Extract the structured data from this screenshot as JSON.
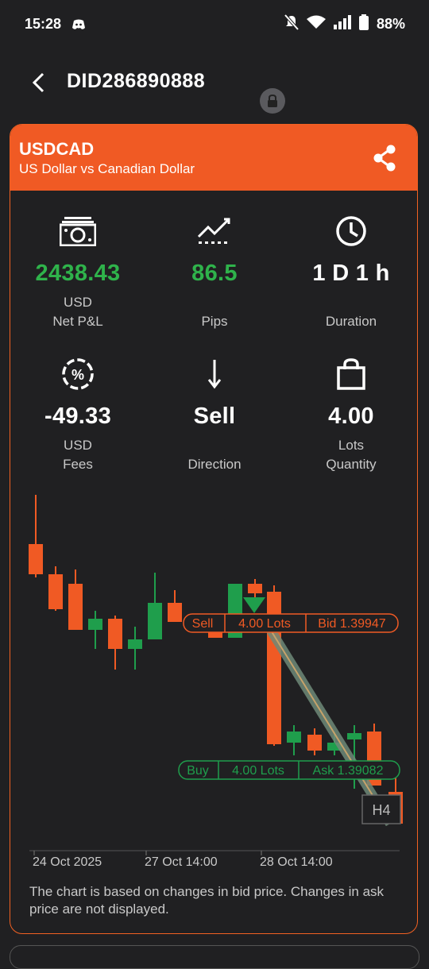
{
  "status": {
    "time": "15:28",
    "battery": "88%"
  },
  "header": {
    "title": "DID286890888"
  },
  "card": {
    "symbol": "USDCAD",
    "description": "US Dollar vs Canadian Dollar",
    "stats": [
      {
        "icon": "money-icon",
        "value": "2438.43",
        "unit": "USD",
        "label": "Net P&L",
        "color": "#2fb34b"
      },
      {
        "icon": "trend-chart-icon",
        "value": "86.5",
        "unit": "",
        "label": "Pips",
        "color": "#2fb34b"
      },
      {
        "icon": "clock-icon",
        "value": "1 D 1 h",
        "unit": "",
        "label": "Duration",
        "color": "#ffffff"
      },
      {
        "icon": "percent-icon",
        "value": "-49.33",
        "unit": "USD",
        "label": "Fees",
        "color": "#ffffff"
      },
      {
        "icon": "arrow-down-icon",
        "value": "Sell",
        "unit": "",
        "label": "Direction",
        "color": "#ffffff"
      },
      {
        "icon": "shopping-bag-icon",
        "value": "4.00",
        "unit": "Lots",
        "label": "Quantity",
        "color": "#ffffff"
      }
    ]
  },
  "chart": {
    "sell_tag": {
      "side": "Sell",
      "lots": "4.00 Lots",
      "price": "Bid 1.39947"
    },
    "buy_tag": {
      "side": "Buy",
      "lots": "4.00 Lots",
      "price": "Ask 1.39082"
    },
    "timeframe": "H4",
    "x_labels": [
      "24 Oct 2025",
      "27 Oct 14:00",
      "28 Oct 14:00"
    ],
    "colors": {
      "up": "#1f9e4c",
      "down": "#f05a24"
    }
  },
  "chart_note": "The chart is based on changes in bid price. Changes in ask price are not displayed."
}
